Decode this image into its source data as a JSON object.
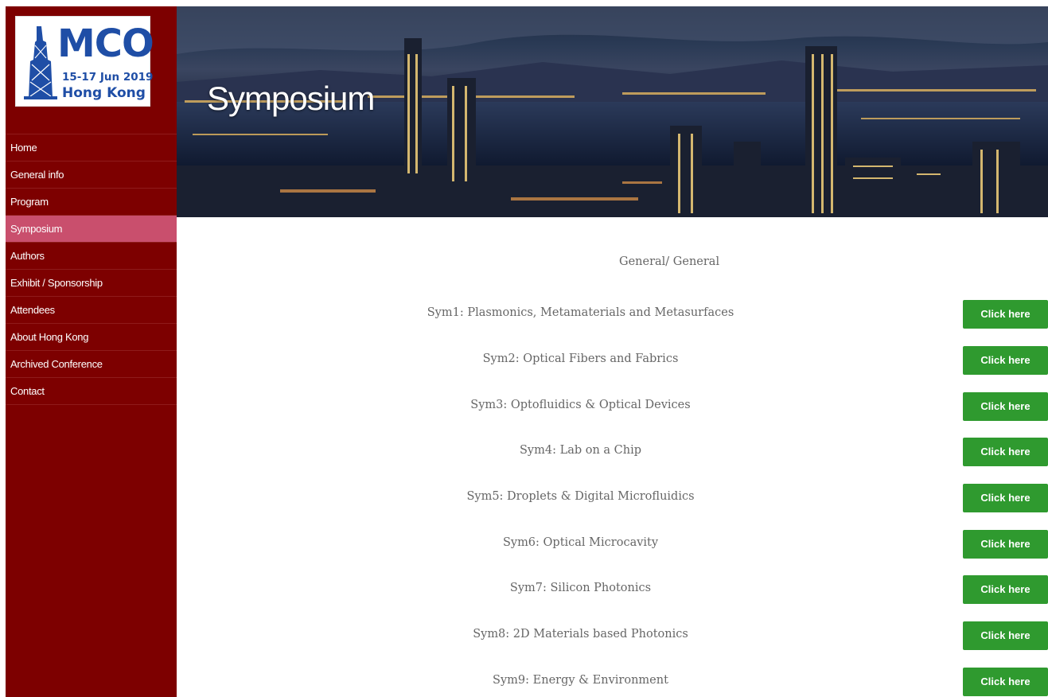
{
  "logo": {
    "acronym": "MCO",
    "dates": "15-17 Jun 2019",
    "city": "Hong Kong"
  },
  "nav": [
    {
      "label": "Home",
      "active": false
    },
    {
      "label": "General info",
      "active": false
    },
    {
      "label": "Program",
      "active": false
    },
    {
      "label": "Symposium",
      "active": true
    },
    {
      "label": "Authors",
      "active": false
    },
    {
      "label": "Exhibit / Sponsorship",
      "active": false
    },
    {
      "label": "Attendees",
      "active": false
    },
    {
      "label": "About Hong Kong",
      "active": false
    },
    {
      "label": "Archived Conference",
      "active": false
    },
    {
      "label": "Contact",
      "active": false
    }
  ],
  "banner": {
    "title": "Symposium"
  },
  "content": {
    "section_heading": "General/ General",
    "button_label": "Click here",
    "symposia": [
      "Sym1: Plasmonics, Metamaterials and Metasurfaces",
      "Sym2: Optical Fibers and Fabrics",
      "Sym3: Optofluidics & Optical Devices",
      "Sym4: Lab on a Chip",
      "Sym5: Droplets & Digital Microfluidics",
      "Sym6: Optical Microcavity",
      "Sym7: Silicon Photonics",
      "Sym8: 2D Materials based Photonics",
      "Sym9: Energy & Environment"
    ]
  },
  "colors": {
    "sidebar": "#7d0000",
    "nav_active": "#c94f6d",
    "button": "#2f9a2f",
    "text": "#666666",
    "logo_blue": "#1f4ea6"
  }
}
